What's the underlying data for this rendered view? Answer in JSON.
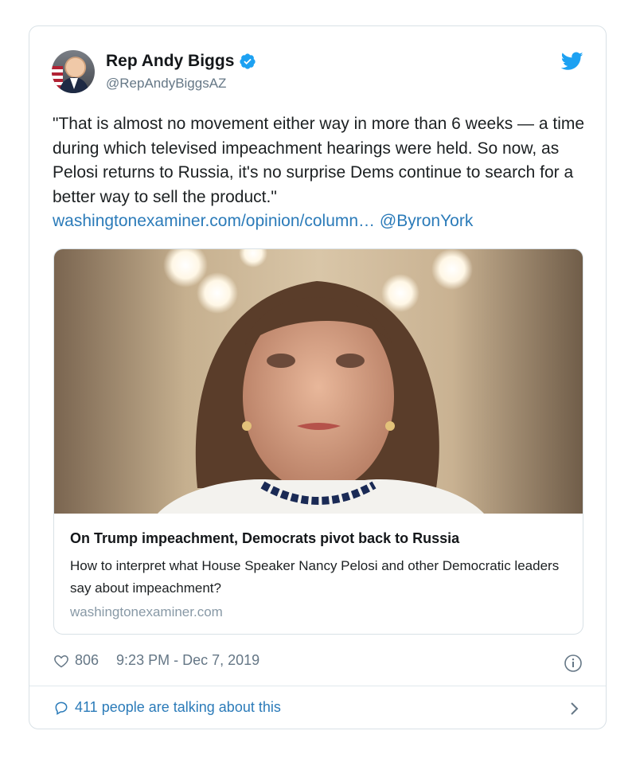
{
  "tweet": {
    "author_name": "Rep Andy Biggs",
    "author_handle": "@RepAndyBiggsAZ",
    "text": "\"That is almost no movement either way in more than 6 weeks — a time during which televised impeachment hearings were held. So now, as Pelosi returns to Russia, it's no surprise Dems continue to search for a better way to sell the product.\"",
    "link_url_text": "washingtonexaminer.com/opinion/column…",
    "mention": "@ByronYork",
    "likes": "806",
    "timestamp": "9:23 PM - Dec 7, 2019",
    "talking": "411 people are talking about this"
  },
  "card": {
    "title": "On Trump impeachment, Democrats pivot back to Russia",
    "description": "How to interpret what House Speaker Nancy Pelosi and other Democratic leaders say about impeachment?",
    "domain": "washingtonexaminer.com"
  },
  "icons": {
    "verified": "verified-badge-icon",
    "brand": "twitter-bird-icon",
    "like": "heart-icon",
    "info": "info-icon",
    "reply": "speech-bubble-icon",
    "more": "chevron-right-icon"
  },
  "colors": {
    "accent": "#1da1f2",
    "link": "#2b7bb9",
    "secondary_text": "#657786",
    "border": "#e1e8ed"
  }
}
